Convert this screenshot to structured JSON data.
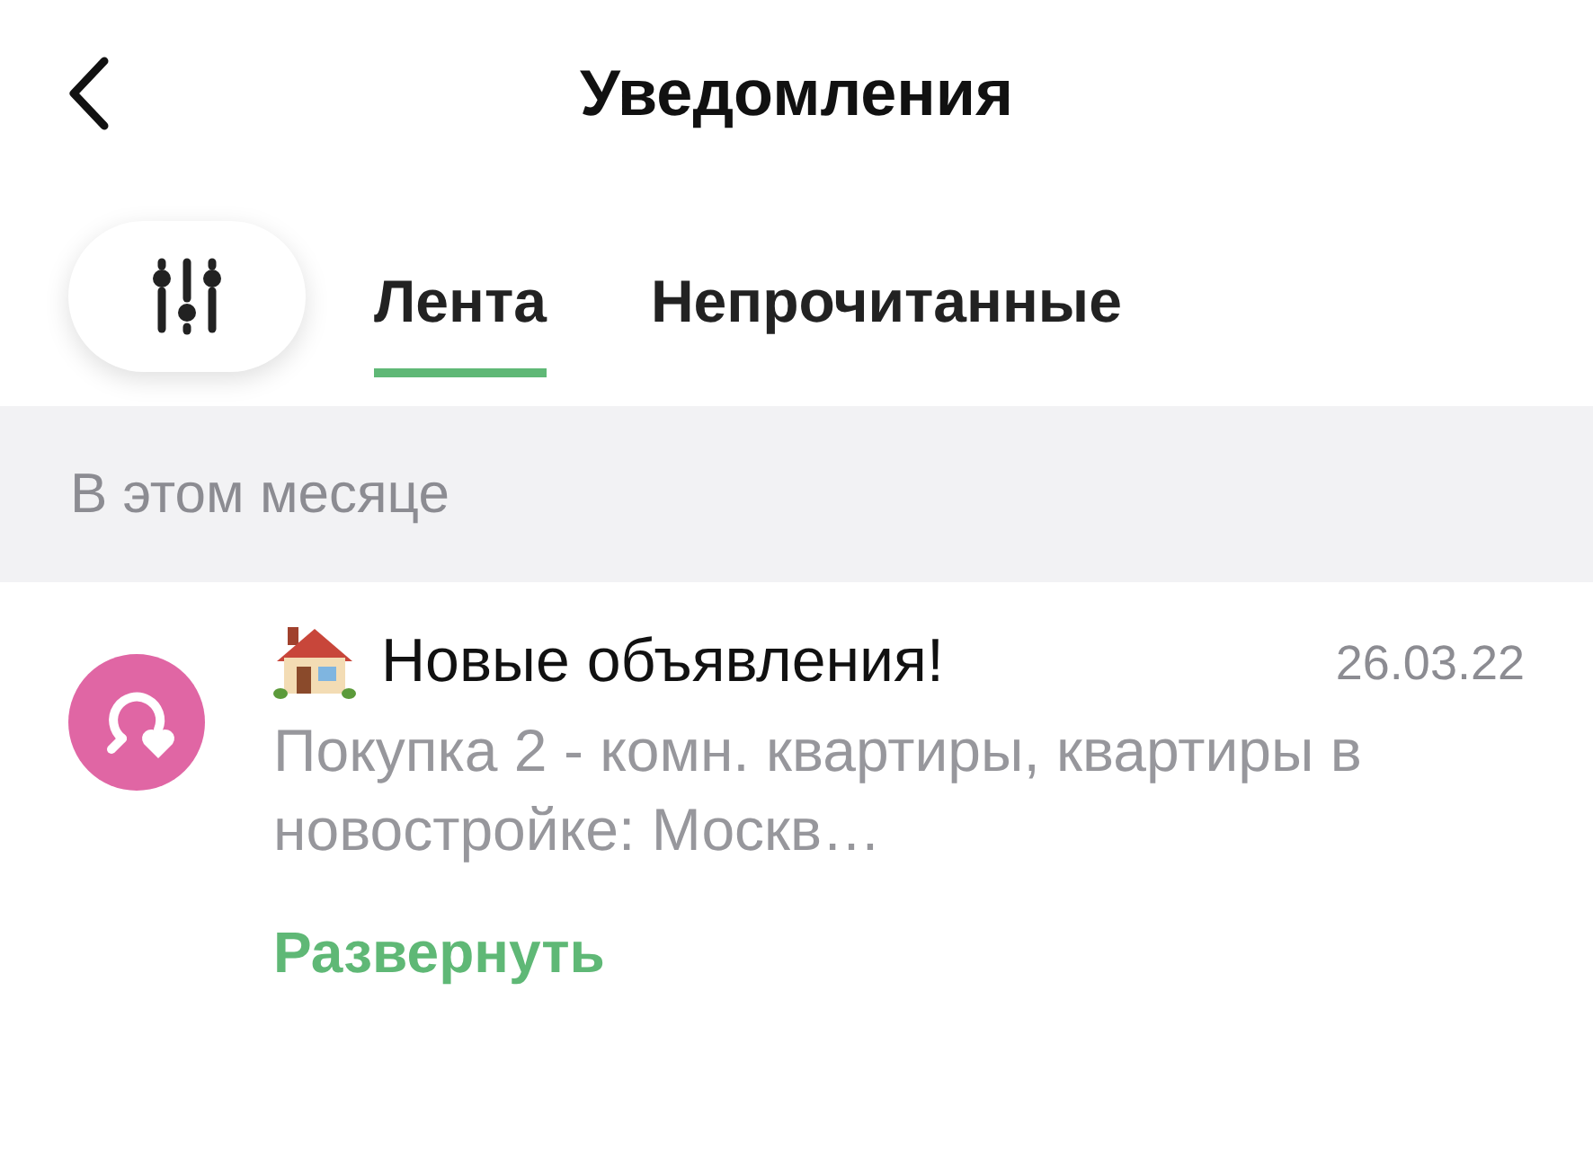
{
  "header": {
    "title": "Уведомления"
  },
  "tabs": [
    {
      "label": "Лента",
      "selected": true
    },
    {
      "label": "Непрочитанные",
      "selected": false
    }
  ],
  "section": {
    "title": "В этом месяце"
  },
  "notifications": [
    {
      "title": "Новые объявления!",
      "date": "26.03.22",
      "text": "Покупка 2 - комн. квартиры, квартиры в новостройке: Москв…",
      "action": "Развернуть"
    }
  ]
}
